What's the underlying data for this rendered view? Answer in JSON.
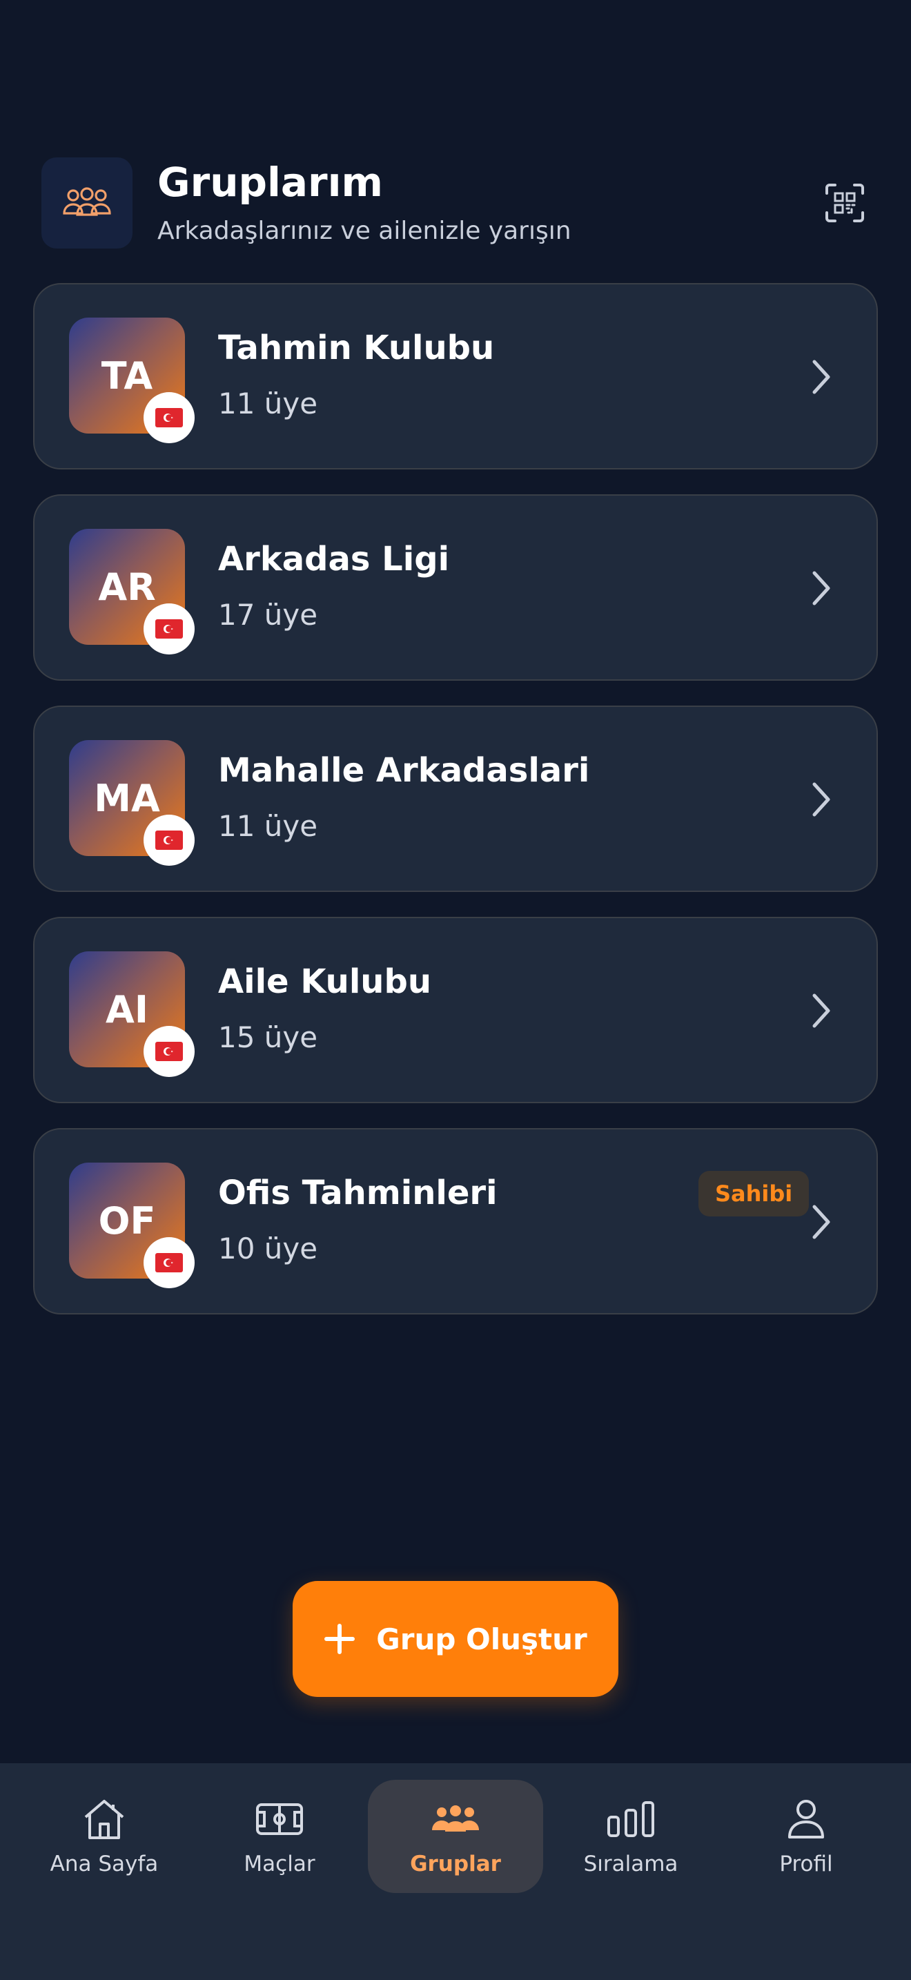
{
  "header": {
    "title": "Gruplarım",
    "subtitle": "Arkadaşlarınız ve ailenizle yarışın",
    "icon": "users-icon",
    "action_icon": "qr-code-icon"
  },
  "groups": [
    {
      "initials": "TA",
      "name": "Tahmin Kulubu",
      "members": "11 üye",
      "flag": "turkey-flag",
      "badge": ""
    },
    {
      "initials": "AR",
      "name": "Arkadas Ligi",
      "members": "17 üye",
      "flag": "turkey-flag",
      "badge": ""
    },
    {
      "initials": "MA",
      "name": "Mahalle Arkadaslari",
      "members": "11 üye",
      "flag": "turkey-flag",
      "badge": ""
    },
    {
      "initials": "AI",
      "name": "Aile Kulubu",
      "members": "15 üye",
      "flag": "turkey-flag",
      "badge": ""
    },
    {
      "initials": "OF",
      "name": "Ofis Tahminleri",
      "members": "10 üye",
      "flag": "turkey-flag",
      "badge": "Sahibi"
    }
  ],
  "create_button": {
    "label": "Grup Oluştur",
    "icon": "plus-icon"
  },
  "nav": {
    "items": [
      {
        "label": "Ana Sayfa",
        "icon": "home-icon"
      },
      {
        "label": "Maçlar",
        "icon": "pitch-icon"
      },
      {
        "label": "Gruplar",
        "icon": "users-icon",
        "active": true
      },
      {
        "label": "Sıralama",
        "icon": "bar-chart-icon"
      },
      {
        "label": "Profil",
        "icon": "user-icon"
      }
    ]
  },
  "colors": {
    "background": "#0f1729",
    "card": "#1f2a3c",
    "accent": "#ff7f0a",
    "active_nav_label": "#ffa45c"
  }
}
